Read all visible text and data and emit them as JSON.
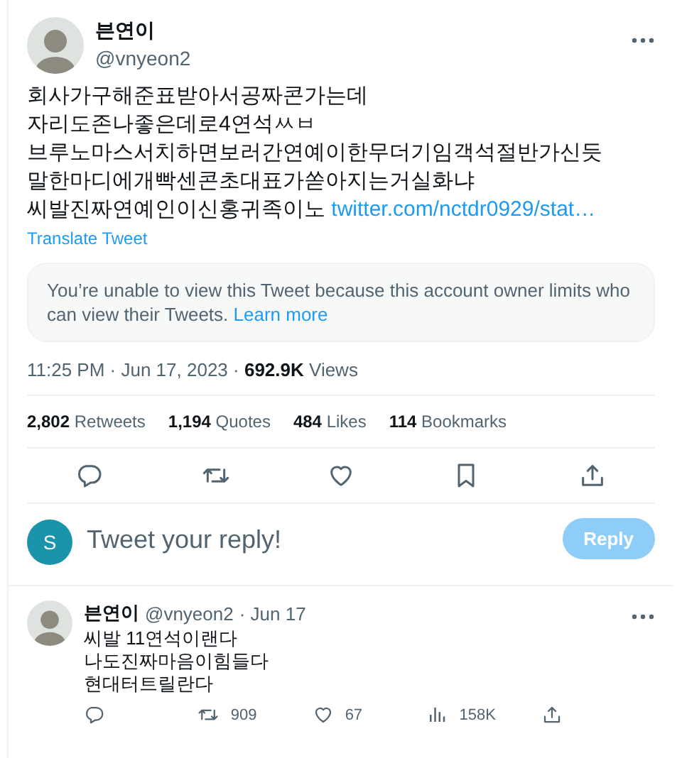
{
  "tweet": {
    "display_name": "븐연이",
    "handle": "@vnyeon2",
    "lines": [
      "회사가구해준표받아서공짜콘가는데",
      "자리도존나좋은데로4연석ㅆㅂ",
      "브루노마스서치하면보러간연예이한무더기임객석절반가신듯",
      "말한마디에개빡센콘초대표가쏟아지는거실화냐",
      "씨발진짜연예인이신홍귀족이노"
    ],
    "link": "twitter.com/nctdr0929/stat…",
    "translate": "Translate Tweet",
    "notice": {
      "text": "You’re unable to view this Tweet because this account owner limits who can view their Tweets.",
      "link": "Learn more"
    },
    "meta": "11:25 PM · Jun 17, 2023 · **692.9K** Views",
    "stats": [
      "**2,802** Retweets",
      "**1,194** Quotes",
      "**484** Likes",
      "**114** Bookmarks"
    ],
    "actions": [
      {
        "kind": "reply"
      },
      {
        "kind": "retweet"
      },
      {
        "kind": "like"
      },
      {
        "kind": "bookmark"
      },
      {
        "kind": "share"
      }
    ]
  },
  "composer": {
    "avatar_letter": "S",
    "placeholder": "Tweet your reply!",
    "button": "Reply",
    "disabled": true
  },
  "reply": {
    "display_name": "븐연이",
    "handle": "@vnyeon2",
    "date": "· Jun 17",
    "lines": [
      "씨발 11연석이랜다",
      "나도진짜마음이힘들다",
      "현대터트릴란다"
    ],
    "actions": [
      {
        "kind": "reply"
      },
      {
        "kind": "retweet",
        "count": "909"
      },
      {
        "kind": "like",
        "count": "67"
      },
      {
        "kind": "views",
        "count": "158K"
      },
      {
        "kind": "share"
      }
    ]
  }
}
